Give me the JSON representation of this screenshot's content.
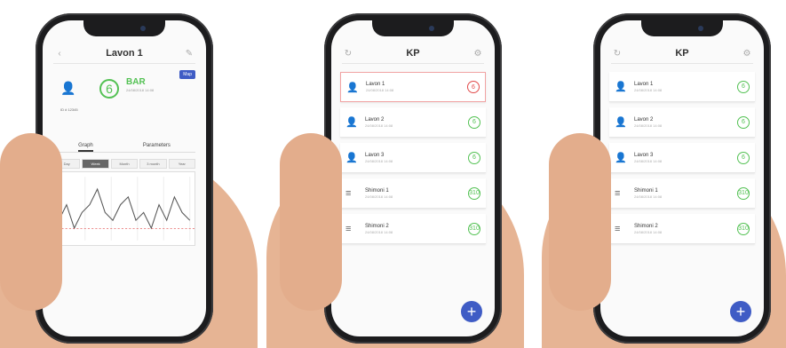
{
  "phone1": {
    "title": "Lavon 1",
    "status_value": "6",
    "status_unit": "BAR",
    "status_text": "24/08/2018 14:08",
    "map_label": "Map",
    "person_code": "ID # 12345",
    "tabs": [
      "Graph",
      "Parameters"
    ],
    "time_chips": [
      "Day",
      "Week",
      "Month",
      "3 month",
      "Year"
    ],
    "selected_chip": "Week"
  },
  "phone2": {
    "title": "KP",
    "rows": [
      {
        "name": "Lavon 1",
        "sub": "24/08/2018 14:08",
        "value": "6",
        "selected": true
      },
      {
        "name": "Lavon 2",
        "sub": "24/08/2018 14:08",
        "value": "6",
        "selected": false
      },
      {
        "name": "Lavon 3",
        "sub": "24/08/2018 14:08",
        "value": "6",
        "selected": false
      },
      {
        "name": "Shimoni 1",
        "sub": "24/08/2018 14:08",
        "value": "310",
        "selected": false
      },
      {
        "name": "Shimoni 2",
        "sub": "24/08/2018 14:08",
        "value": "310",
        "selected": false
      }
    ]
  },
  "phone3": {
    "title": "KP",
    "rows": [
      {
        "name": "Lavon 1",
        "sub": "24/08/2018 14:08",
        "value": "6"
      },
      {
        "name": "Lavon 2",
        "sub": "24/08/2018 14:08",
        "value": "6"
      },
      {
        "name": "Lavon 3",
        "sub": "24/08/2018 14:08",
        "value": "6"
      },
      {
        "name": "Shimoni 1",
        "sub": "24/08/2018 14:08",
        "value": "310"
      },
      {
        "name": "Shimoni 2",
        "sub": "24/08/2018 14:08",
        "value": "310"
      }
    ]
  },
  "graph": {
    "series": [
      4,
      6,
      3,
      5,
      6,
      8,
      5,
      4,
      6,
      7,
      4,
      5,
      3,
      6,
      4,
      7,
      5,
      4
    ]
  }
}
